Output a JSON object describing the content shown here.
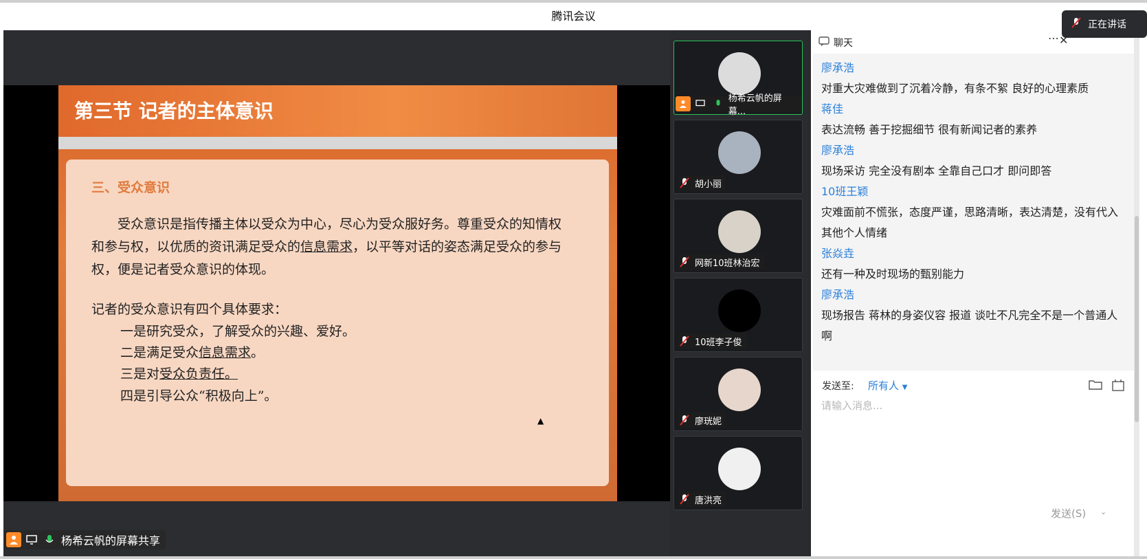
{
  "window": {
    "title": "腾讯会议"
  },
  "slide": {
    "title": "第三节  记者的主体意识",
    "section": "三、受众意识",
    "paragraph_part1": "受众意识是指传播主体以受众为中心，尽心为受众服好务。尊重受众的知情权和参与权，以优质的资讯满足受众的",
    "paragraph_link": "信息需求",
    "paragraph_part2": "，以平等对话的姿态满足受众的参与权，便是记者受众意识的体现。",
    "req_intro": "记者的受众意识有四个具体要求：",
    "req1": "一是研究受众，了解受众的兴趣、爱好。",
    "req2_a": "二是满足受众",
    "req2_b": "信息需求",
    "req2_c": "。",
    "req3_a": "三是对",
    "req3_b": "受众负责任。",
    "req4": "四是引导公众“积极向上”。"
  },
  "share_label": "杨希云帆的屏幕共享",
  "participants": [
    {
      "name": "杨希云帆的屏幕...",
      "active": true,
      "color": "#dcdcdc"
    },
    {
      "name": "胡小丽",
      "active": false,
      "color": "#a9b3bf"
    },
    {
      "name": "网新10班林治宏",
      "active": false,
      "color": "#d8d2c8"
    },
    {
      "name": "10班李子俊",
      "active": false,
      "color": "#000000"
    },
    {
      "name": "廖珖妮",
      "active": false,
      "color": "#e6d6cc"
    },
    {
      "name": "唐洪亮",
      "active": false,
      "color": "#f0f0f0"
    }
  ],
  "chat": {
    "title": "聊天",
    "messages": [
      {
        "sender": "廖承浩",
        "text": "对重大灾难做到了沉着冷静，有条不絮 良好的心理素质"
      },
      {
        "sender": "蒋佳",
        "text": "表达流畅 善于挖掘细节 很有新闻记者的素养"
      },
      {
        "sender": "廖承浩",
        "text": "现场采访 完全没有剧本 全靠自己口才 即问即答"
      },
      {
        "sender": "10班王颖",
        "text": "灾难面前不慌张，态度严谨，思路清晰，表达清楚，没有代入其他个人情绪"
      },
      {
        "sender": "张焱垚",
        "text": "还有一种及时现场的甄别能力"
      },
      {
        "sender": "廖承浩",
        "text": "现场报告 蒋林的身姿仪容 报道 谈吐不凡完全不是一个普通人啊"
      }
    ],
    "send_to_label": "发送至:",
    "send_to_value": "所有人",
    "placeholder": "请输入消息...",
    "send_button": "发送(S)"
  },
  "toast": {
    "text": "正在讲话"
  }
}
